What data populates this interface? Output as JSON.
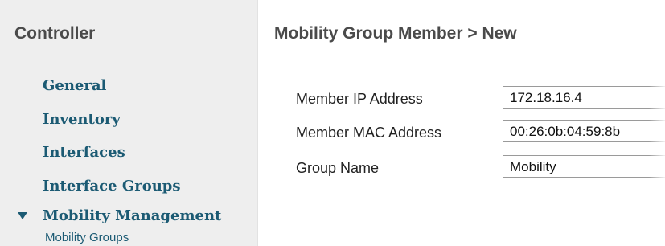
{
  "sidebar": {
    "title": "Controller",
    "items": [
      {
        "label": "General"
      },
      {
        "label": "Inventory"
      },
      {
        "label": "Interfaces"
      },
      {
        "label": "Interface Groups"
      },
      {
        "label": "Mobility Management",
        "expanded": true
      }
    ],
    "sub_items": [
      {
        "label": "Mobility Groups"
      }
    ],
    "link_color": "#1b5a73"
  },
  "main": {
    "title": "Mobility Group Member > New",
    "form": {
      "member_ip": {
        "label": "Member IP Address",
        "value": "172.18.16.4"
      },
      "member_mac": {
        "label": "Member MAC Address",
        "value": "00:26:0b:04:59:8b"
      },
      "group_name": {
        "label": "Group Name",
        "value": "Mobility"
      }
    }
  }
}
